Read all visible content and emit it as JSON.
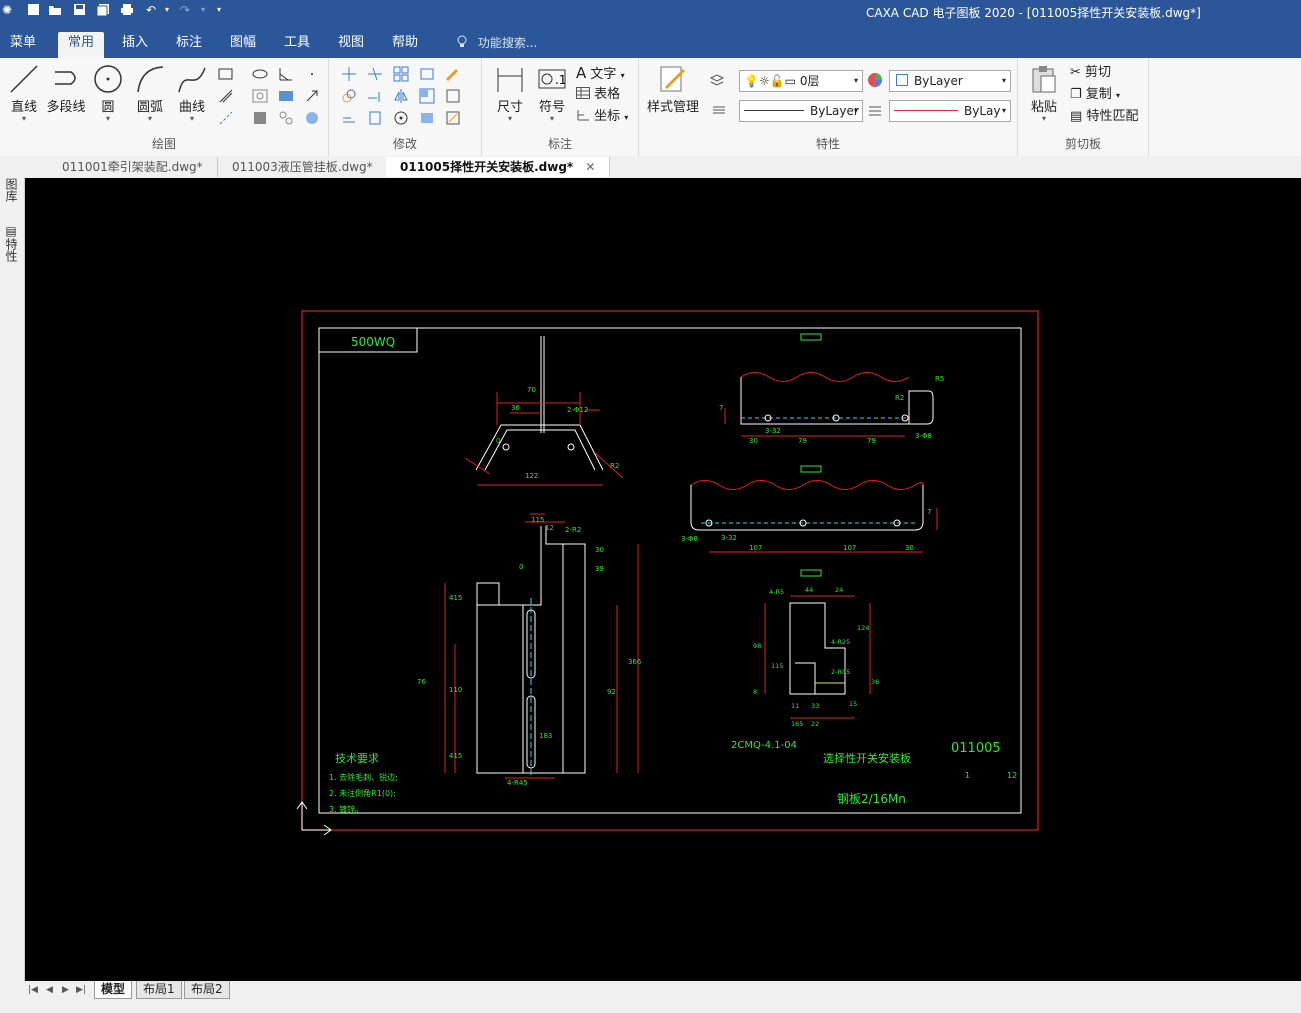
{
  "window": {
    "title": "CAXA CAD 电子图板 2020 - [011005择性开关安装板.dwg*]"
  },
  "menu_tabs": [
    "菜单",
    "常用",
    "插入",
    "标注",
    "图幅",
    "工具",
    "视图",
    "帮助"
  ],
  "active_tab": "常用",
  "search_placeholder": "功能搜索...",
  "ribbon": {
    "draw": {
      "label": "绘图",
      "tools": [
        "直线",
        "多段线",
        "圆",
        "圆弧",
        "曲线"
      ]
    },
    "modify": {
      "label": "修改"
    },
    "annotate": {
      "label": "标注",
      "tools": [
        "尺寸",
        "符号"
      ],
      "small": [
        "文字",
        "表格",
        "坐标"
      ]
    },
    "props": {
      "label": "特性",
      "style_manage": "样式管理",
      "layer": "0层",
      "color": "ByLayer",
      "linetype": "ByLayer",
      "lineweight": "ByLay"
    },
    "clipboard": {
      "label": "剪切板",
      "paste": "粘贴",
      "small": [
        "剪切",
        "复制",
        "特性匹配"
      ]
    }
  },
  "doc_tabs": [
    "011001牵引架装配.dwg*",
    "011003液压管挂板.dwg*",
    "011005择性开关安装板.dwg*"
  ],
  "active_doc": "011005择性开关安装板.dwg*",
  "side_panels": [
    "图库",
    "特性"
  ],
  "layout_tabs": [
    "模型",
    "布局1",
    "布局2"
  ],
  "drawing": {
    "code_box": "500WQ",
    "tech_req_title": "技术要求",
    "tech_req_items": [
      "1. 去除毛刺、锐边;",
      "2. 未注倒角R1(0);",
      "3. 镀锌。"
    ],
    "part_number": "011005",
    "part_name": "选择性开关安装板",
    "spec": "2CMQ-4.1-04",
    "material": "钢板2/16Mn",
    "scale": "1",
    "sheets": "12",
    "dims": {
      "top_a": "70",
      "top_b": "36",
      "top_c": "2-Φ12",
      "top_d": "122",
      "top_e": "0",
      "top_f": "R2",
      "r15": "R5",
      "r12": "R2",
      "d7": "7",
      "d30": "30",
      "d79a": "79",
      "d79b": "79",
      "d32": "3-32",
      "dh": "3-Φ8",
      "mid_30": "30",
      "mid_107a": "107",
      "mid_107b": "107",
      "mid_30b": "30",
      "mid_7": "7",
      "mid_h": "3-Φ8",
      "mid_32": "3-32",
      "s_44": "44",
      "s_24": "24",
      "s_4r5": "4-R5",
      "s_4r25": "4-R25",
      "s_2r05": "2-R05",
      "s_98": "98",
      "s_115": "115",
      "s_8": "8",
      "s_165": "165",
      "s_22": "22",
      "s_11": "11",
      "s_33": "33",
      "s_15": "15",
      "s_124": "124",
      "s_36": "36",
      "e_115": "115",
      "e_12": "12",
      "e_2r2": "2-R2",
      "e_0": "0",
      "e_30": "30",
      "e_39": "39",
      "e_415": "415",
      "e_76": "76",
      "e_110": "110",
      "e_92": "92",
      "e_366": "366",
      "e_183": "183",
      "e_4r45": "4-R45"
    }
  }
}
